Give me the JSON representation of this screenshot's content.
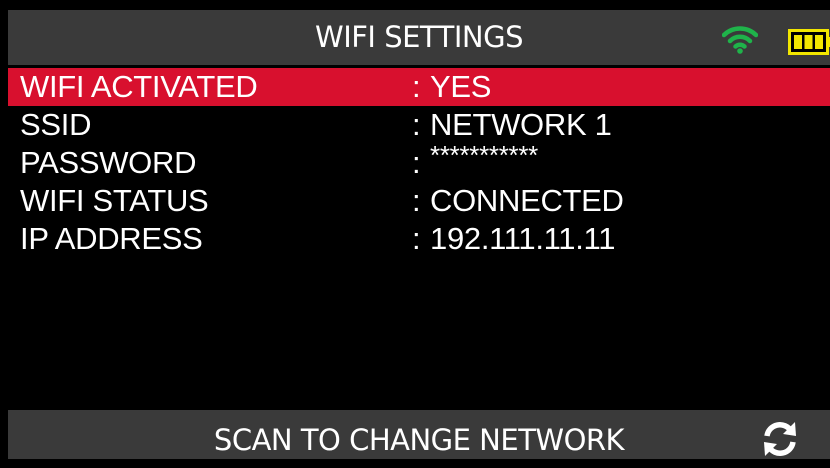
{
  "header": {
    "title": "WIFI SETTINGS",
    "status_icons": [
      "wifi-signal-icon",
      "battery-icon"
    ],
    "wifi_color": "#1fb34a",
    "battery_color": "#f2e600"
  },
  "settings": {
    "separator": ":",
    "rows": [
      {
        "label": "WIFI ACTIVATED",
        "value": "YES",
        "selected": true
      },
      {
        "label": "SSID",
        "value": "NETWORK 1",
        "selected": false
      },
      {
        "label": "PASSWORD",
        "value": "***********",
        "selected": false
      },
      {
        "label": "WIFI STATUS",
        "value": "CONNECTED",
        "selected": false
      },
      {
        "label": "IP ADDRESS",
        "value": "192.111.11.11",
        "selected": false
      }
    ]
  },
  "footer": {
    "label": "SCAN TO CHANGE NETWORK",
    "icon": "refresh-icon"
  },
  "colors": {
    "selection": "#d8102e",
    "bar_background": "#3a3a3a",
    "background": "#000000",
    "text": "#ffffff"
  }
}
